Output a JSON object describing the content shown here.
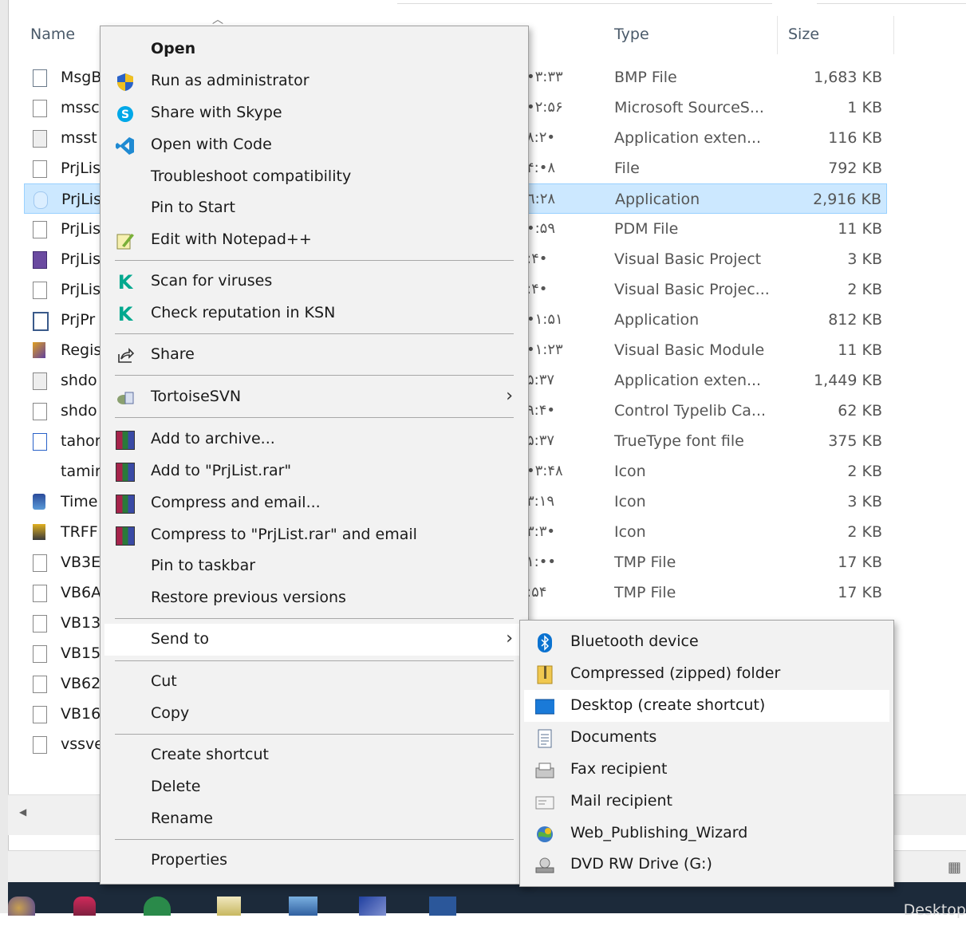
{
  "columns": {
    "name": "Name",
    "type": "Type",
    "size": "Size"
  },
  "files": [
    {
      "name": "MsgB",
      "time": "•٣:٣٣",
      "type": "BMP File",
      "size": "1,683 KB",
      "icon": "bmp-file-icon"
    },
    {
      "name": "mssc",
      "time": "•٢:۵۶",
      "type": "Microsoft SourceS...",
      "size": "1 KB",
      "icon": "generic-file-icon"
    },
    {
      "name": "msst",
      "time": "٨:٢•",
      "type": "Application exten...",
      "size": "116 KB",
      "icon": "dll-file-icon"
    },
    {
      "name": "PrjLis",
      "time": "۴:•٨",
      "type": "File",
      "size": "792 KB",
      "icon": "generic-file-icon"
    },
    {
      "name": "PrjLis",
      "time": "٦:٢٨",
      "type": "Application",
      "size": "2,916 KB",
      "icon": "application-icon",
      "selected": true
    },
    {
      "name": "PrjLis",
      "time": "•:۵٩",
      "type": "PDM File",
      "size": "11 KB",
      "icon": "generic-file-icon"
    },
    {
      "name": "PrjLis",
      "time": ":۴•",
      "type": "Visual Basic Project",
      "size": "3 KB",
      "icon": "vb-project-icon"
    },
    {
      "name": "PrjLis",
      "time": ":۴•",
      "type": "Visual Basic Projec...",
      "size": "2 KB",
      "icon": "generic-file-icon"
    },
    {
      "name": "PrjPr",
      "time": "•١:۵١",
      "type": "Application",
      "size": "812 KB",
      "icon": "application-window-icon"
    },
    {
      "name": "Regis",
      "time": "•١:٢٣",
      "type": "Visual Basic Module",
      "size": "11 KB",
      "icon": "vb-module-icon"
    },
    {
      "name": "shdo",
      "time": "۵:٣٧",
      "type": "Application exten...",
      "size": "1,449 KB",
      "icon": "dll-file-icon"
    },
    {
      "name": "shdo",
      "time": "٩:۴•",
      "type": "Control Typelib Ca...",
      "size": "62 KB",
      "icon": "generic-file-icon"
    },
    {
      "name": "tahor",
      "time": "۵:٣٧",
      "type": "TrueType font file",
      "size": "375 KB",
      "icon": "font-file-icon"
    },
    {
      "name": "tamir",
      "time": "•٣:۴٨",
      "type": "Icon",
      "size": "2 KB",
      "icon": "blank-icon"
    },
    {
      "name": "Time",
      "time": "٣:١٩",
      "type": "Icon",
      "size": "3 KB",
      "icon": "clock-app-icon"
    },
    {
      "name": "TRFF",
      "time": "٣:٣•",
      "type": "Icon",
      "size": "2 KB",
      "icon": "transfer-icon"
    },
    {
      "name": "VB3E",
      "time": "١:••",
      "type": "TMP File",
      "size": "17 KB",
      "icon": "generic-file-icon"
    },
    {
      "name": "VB6A",
      "time": ":۵۴",
      "type": "TMP File",
      "size": "17 KB",
      "icon": "generic-file-icon"
    },
    {
      "name": "VB13",
      "time": "",
      "type": "",
      "size": "",
      "icon": "generic-file-icon"
    },
    {
      "name": "VB15",
      "time": "",
      "type": "",
      "size": "",
      "icon": "generic-file-icon"
    },
    {
      "name": "VB62",
      "time": "",
      "type": "",
      "size": "",
      "icon": "generic-file-icon"
    },
    {
      "name": "VB16",
      "time": "",
      "type": "",
      "size": "",
      "icon": "generic-file-icon"
    },
    {
      "name": "vssve",
      "time": "",
      "type": "",
      "size": "",
      "icon": "generic-file-icon"
    }
  ],
  "context_menu": {
    "open": "Open",
    "run_as_admin": "Run as administrator",
    "share_skype": "Share with Skype",
    "open_with_code": "Open with Code",
    "troubleshoot": "Troubleshoot compatibility",
    "pin_start": "Pin to Start",
    "edit_notepadpp": "Edit with Notepad++",
    "scan_viruses": "Scan for viruses",
    "check_reputation": "Check reputation in KSN",
    "share": "Share",
    "tortoisesvn": "TortoiseSVN",
    "add_archive": "Add to archive...",
    "add_rar": "Add to \"PrjList.rar\"",
    "compress_email": "Compress and email...",
    "compress_rar_email": "Compress to \"PrjList.rar\" and email",
    "pin_taskbar": "Pin to taskbar",
    "restore_versions": "Restore previous versions",
    "send_to": "Send to",
    "cut": "Cut",
    "copy": "Copy",
    "create_shortcut": "Create shortcut",
    "delete": "Delete",
    "rename": "Rename",
    "properties": "Properties"
  },
  "send_to_menu": {
    "bluetooth": "Bluetooth device",
    "zip": "Compressed (zipped) folder",
    "desktop": "Desktop (create shortcut)",
    "documents": "Documents",
    "fax": "Fax recipient",
    "mail": "Mail recipient",
    "web_wizard": "Web_Publishing_Wizard",
    "dvd": "DVD RW Drive (G:)"
  },
  "taskbar": {
    "desktop_label": "Desktop"
  },
  "colors": {
    "selection": "#cce8ff",
    "menu_bg": "#f2f2f2",
    "accent": "#0078d7"
  }
}
